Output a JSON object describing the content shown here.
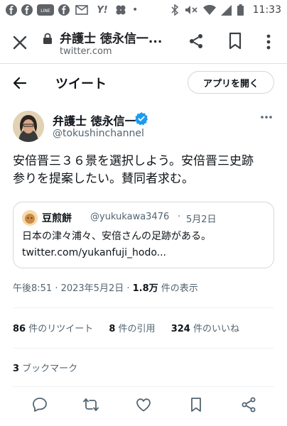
{
  "status_bar": {
    "time": "11:33",
    "icons": [
      "facebook-icon",
      "facebook-icon",
      "line-icon",
      "facebook-icon",
      "mail-icon",
      "yahoo-icon",
      "app-icon",
      "more-dots-icon",
      "bluetooth-icon",
      "mute-icon",
      "wifi-icon",
      "signal-icon",
      "battery-icon"
    ],
    "line_label": "LINE",
    "yahoo_label": "Y!"
  },
  "browser": {
    "page_title": "弁護士 徳永信一...",
    "url": "twitter.com"
  },
  "header": {
    "title": "ツイート",
    "open_app_label": "アプリを開く"
  },
  "tweet": {
    "author_name": "弁護士 徳永信一",
    "author_handle": "@tokushinchannel",
    "body_line1": "安倍晋三３６景を選択しよう。安倍晋三史跡",
    "body_line2": "参りを提案したい。賛同者求む。",
    "quote": {
      "name": "豆煎餅",
      "handle": "@yukukawa3476",
      "separator": "·",
      "date": "5月2日",
      "text": "日本の津々浦々、安倍さんの足跡がある。",
      "link": "twitter.com/yukanfuji_hodo..."
    },
    "time": "午後8:51 · 2023年5月2日 · ",
    "views_count": "1.8万",
    "views_label": " 件の表示",
    "retweets_count": "86",
    "retweets_label": " 件のリツイート",
    "quotes_count": "8",
    "quotes_label": " 件の引用",
    "likes_count": "324",
    "likes_label": " 件のいいね",
    "bookmarks_count": "3",
    "bookmarks_label": " ブックマーク"
  },
  "colors": {
    "verified": "#1d9bf0",
    "text_primary": "#0f1419",
    "text_secondary": "#536471",
    "border": "#cfd9de"
  }
}
